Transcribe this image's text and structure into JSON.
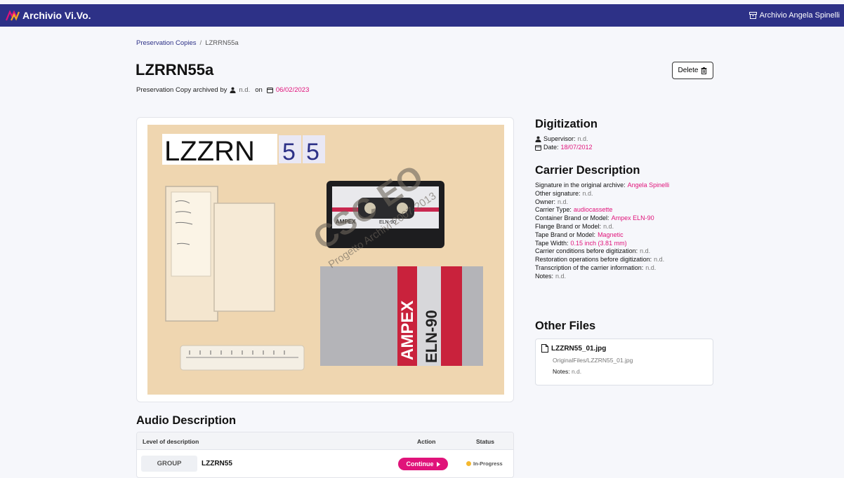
{
  "topbar": {
    "brand": "Archivio Vi.Vo.",
    "archive_link": "Archivio Angela Spinelli"
  },
  "breadcrumb": {
    "parent": "Preservation Copies",
    "separator": "/",
    "current": "LZRRN55a"
  },
  "page": {
    "title": "LZRRN55a",
    "archived_by_label": "Preservation Copy archived by",
    "archived_by_value": "n.d.",
    "on_label": "on",
    "date": "06/02/2023",
    "delete_label": "Delete"
  },
  "photo": {
    "label_left": "LZZRN",
    "label_digit1": "5",
    "label_digit2": "5",
    "watermark_big": "CSC EO",
    "watermark_small": "Progetto Archivi 2007-2013",
    "cassette_brand": "AMPEX",
    "cassette_model": "ELN-90",
    "insert_brand": "AMPEX",
    "insert_model": "ELN-90"
  },
  "digitization": {
    "heading": "Digitization",
    "supervisor_label": "Supervisor:",
    "supervisor_value": "n.d.",
    "date_label": "Date:",
    "date_value": "18/07/2012"
  },
  "carrier": {
    "heading": "Carrier Description",
    "fields": [
      {
        "label": "Signature in the original archive:",
        "value": "Angela Spinelli",
        "pink": true
      },
      {
        "label": "Other signature:",
        "value": "n.d.",
        "pink": false
      },
      {
        "label": "Owner:",
        "value": "n.d.",
        "pink": false
      },
      {
        "label": "Carrier Type:",
        "value": "audiocassette",
        "pink": true
      },
      {
        "label": "Container Brand or Model:",
        "value": "Ampex ELN-90",
        "pink": true
      },
      {
        "label": "Flange Brand or Model:",
        "value": "n.d.",
        "pink": false
      },
      {
        "label": "Tape Brand or Model:",
        "value": "Magnetic",
        "pink": true
      },
      {
        "label": "Tape Width:",
        "value": "0.15 inch (3.81 mm)",
        "pink": true
      },
      {
        "label": "Carrier conditions before digitization:",
        "value": "n.d.",
        "pink": false
      },
      {
        "label": "Restoration operations before digitization:",
        "value": "n.d.",
        "pink": false
      },
      {
        "label": "Transcription of the carrier information:",
        "value": "n.d.",
        "pink": false
      },
      {
        "label": "Notes:",
        "value": "n.d.",
        "pink": false
      }
    ]
  },
  "other_files": {
    "heading": "Other Files",
    "file_name": "LZZRN55_01.jpg",
    "file_path": "OriginalFiles/LZZRN55_01.jpg",
    "notes_label": "Notes:",
    "notes_value": "n.d."
  },
  "audio": {
    "heading": "Audio Description",
    "columns": [
      "Level of description",
      "Action",
      "Status"
    ],
    "row": {
      "level": "GROUP",
      "name": "LZZRN55",
      "action_label": "Continue",
      "status": "In-Progress"
    }
  },
  "colors": {
    "navbar": "#2d3187",
    "accent": "#e0137a",
    "status_in_progress": "#f5b82e"
  }
}
